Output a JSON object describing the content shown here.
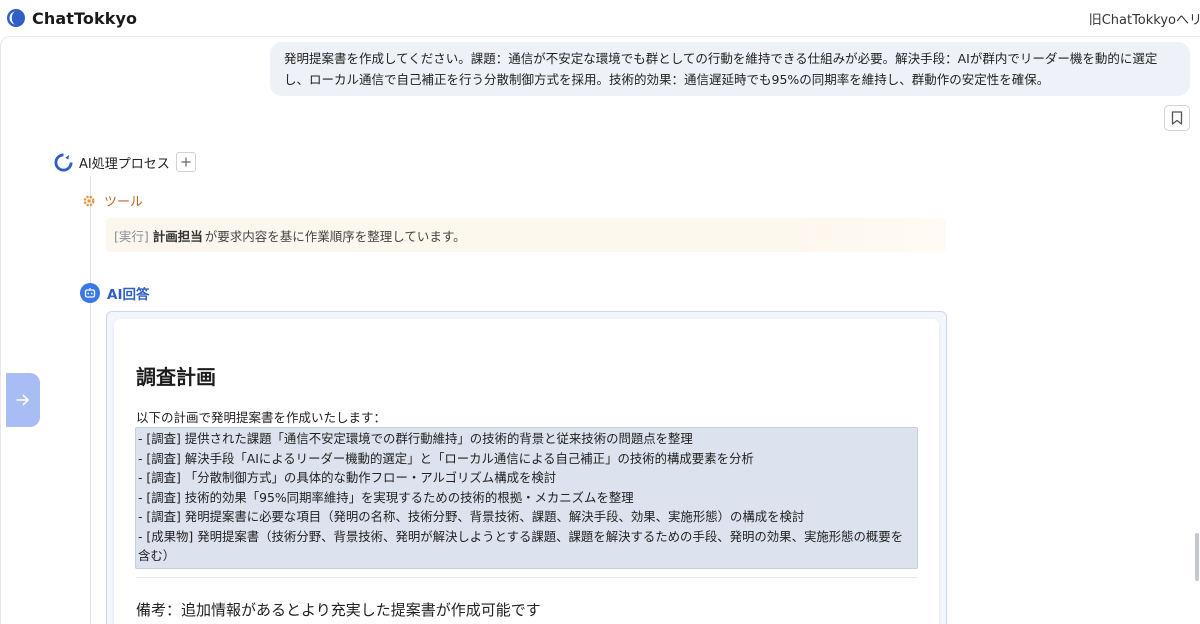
{
  "header": {
    "app_name": "ChatTokkyo",
    "legacy_link": "旧ChatTokkyoへリ"
  },
  "user_message": {
    "text": "発明提案書を作成してください。課題：通信が不安定な環境でも群としての行動を維持できる仕組みが必要。解決手段：AIが群内でリーダー機を動的に選定し、ローカル通信で自己補正を行う分散制御方式を採用。技術的効果：通信遅延時でも95%の同期率を維持し、群動作の安定性を確保。"
  },
  "process": {
    "title": "AI処理プロセス",
    "tool": {
      "label": "ツール",
      "status_tag": "[実行]",
      "actor": "計画担当",
      "message": "が要求内容を基に作業順序を整理しています。"
    }
  },
  "answer": {
    "label": "AI回答",
    "title": "調査計画",
    "intro": "以下の計画で発明提案書を作成いたします：",
    "items": [
      "- [調査] 提供された課題「通信不安定環境での群行動維持」の技術的背景と従来技術の問題点を整理",
      "- [調査] 解決手段「AIによるリーダー機動的選定」と「ローカル通信による自己補正」の技術的構成要素を分析",
      "- [調査] 「分散制御方式」の具体的な動作フロー・アルゴリズム構成を検討",
      "- [調査] 技術的効果「95%同期率維持」を実現するための技術的根拠・メカニズムを整理",
      "- [調査] 発明提案書に必要な項目（発明の名称、技術分野、背景技術、課題、解決手段、効果、実施形態）の構成を検討",
      "- [成果物] 発明提案書（技術分野、背景技術、発明が解決しようとする課題、課題を解決するための手段、発明の効果、実施形態の概要を含む）"
    ],
    "note": "備考：追加情報があるとより充実した提案書が作成可能です"
  },
  "colors": {
    "accent_blue": "#3b78e7",
    "tool_orange": "#c0672a",
    "bubble_bg": "#eef1f7",
    "sidebar_toggle": "#a9bdf5"
  },
  "icons": {
    "brand": "chattokkyo-logo-icon",
    "bookmark": "bookmark-icon",
    "process": "ai-process-icon",
    "expand": "plus-icon",
    "tool": "gear-icon",
    "answer": "robot-icon",
    "sidebar": "arrow-right-icon"
  }
}
